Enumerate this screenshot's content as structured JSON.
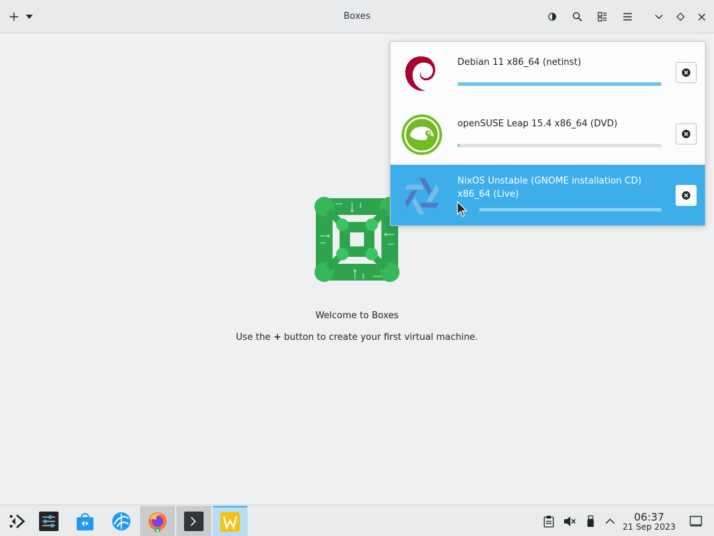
{
  "window": {
    "title": "Boxes"
  },
  "headerbar": {
    "icons": [
      "add-icon",
      "chevron-down-icon",
      "contrast-icon",
      "search-icon",
      "view-mode-icon",
      "hamburger-menu-icon",
      "minimize-icon",
      "maximize-icon",
      "close-icon"
    ]
  },
  "welcome": {
    "title": "Welcome to Boxes",
    "hint_before": "Use the",
    "hint_symbol": "+",
    "hint_after": "button to create your first virtual machine."
  },
  "downloads": {
    "items": [
      {
        "title": "Debian 11 x86_64 (netinst)",
        "progress": 1.0,
        "logo": "debian-logo-icon",
        "logo_color": "#a80030"
      },
      {
        "title": "openSUSE Leap 15.4 x86_64 (DVD)",
        "progress": 0.01,
        "logo": "opensuse-logo-icon",
        "logo_color": "#73ba25"
      },
      {
        "title": "NixOS Unstable (GNOME installation CD) x86_64 (Live)",
        "progress": 0.11,
        "logo": "nixos-logo-icon",
        "logo_color": "#5277c3",
        "selected": true
      }
    ]
  },
  "taskbar": {
    "apps": [
      "application-launcher-icon",
      "system-settings-icon",
      "discover-store-icon",
      "krdc-icon",
      "firefox-icon",
      "terminal-icon",
      "boxes-app-icon"
    ],
    "tray": [
      "clipboard-icon",
      "volume-muted-icon",
      "usb-device-icon",
      "tray-expand-icon",
      "show-desktop-icon"
    ],
    "clock_time": "06:37",
    "clock_date": "21 Sep 2023"
  },
  "colors": {
    "accent": "#3daee9",
    "boxes_green": "#2ea44f"
  }
}
